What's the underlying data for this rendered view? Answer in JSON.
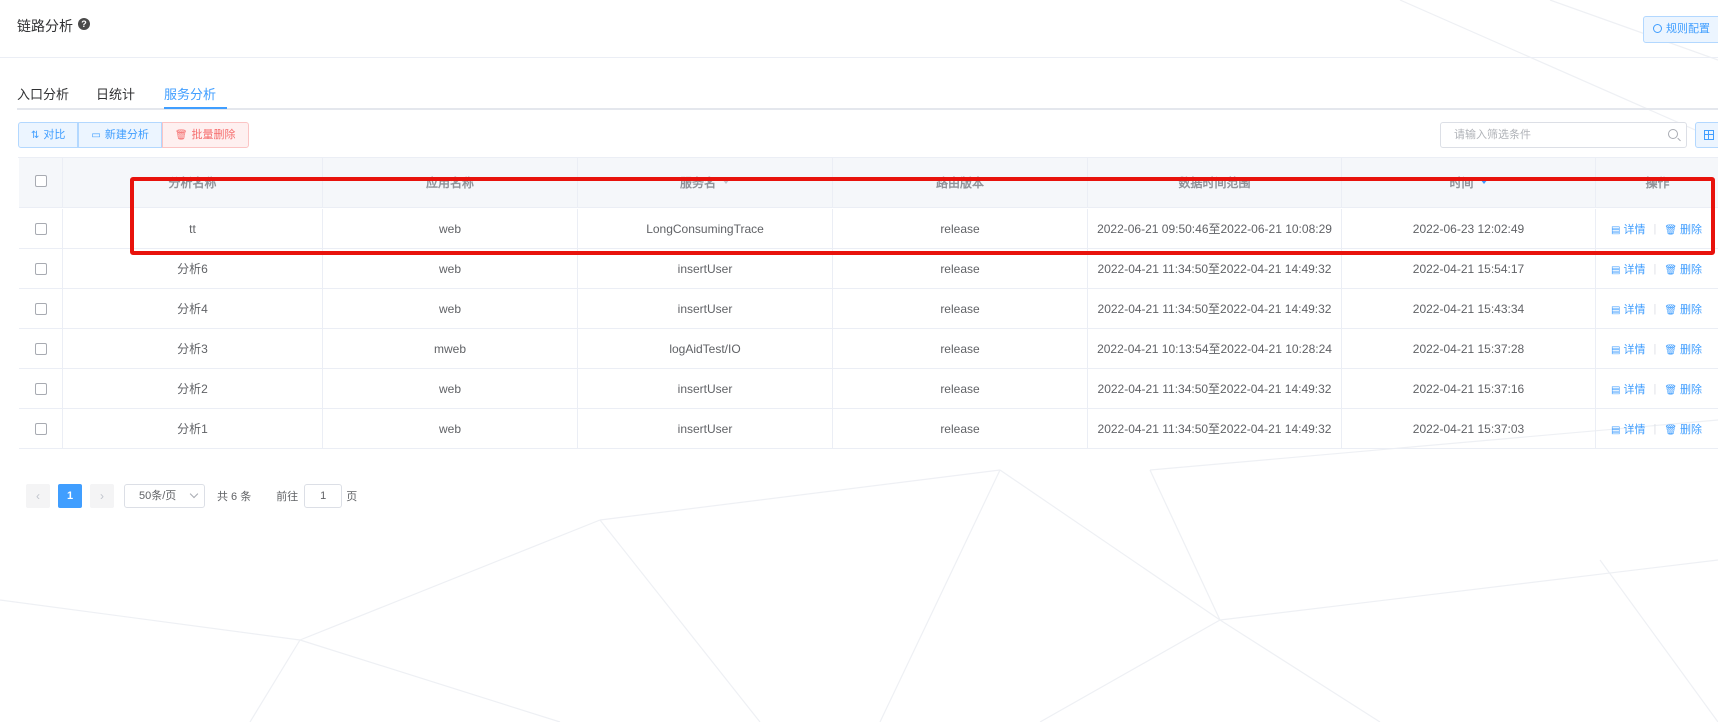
{
  "header": {
    "title": "链路分析",
    "help_icon": "question-circle-icon",
    "rule_config_label": "规则配置"
  },
  "tabs": [
    {
      "label": "入口分析",
      "active": false
    },
    {
      "label": "日统计",
      "active": false
    },
    {
      "label": "服务分析",
      "active": true
    }
  ],
  "toolbar": {
    "compare_label": "对比",
    "new_analysis_label": "新建分析",
    "batch_delete_label": "批量删除",
    "search_placeholder": "请输入筛选条件"
  },
  "table": {
    "columns": [
      "分析名称",
      "应用名称",
      "服务名",
      "路由版本",
      "数据时间范围",
      "时间",
      "操作"
    ],
    "rows": [
      {
        "name": "tt",
        "app": "web",
        "service": "LongConsumingTrace",
        "version": "release",
        "range": "2022-06-21 09:50:46至2022-06-21 10:08:29",
        "time": "2022-06-23 12:02:49"
      },
      {
        "name": "分析6",
        "app": "web",
        "service": "insertUser",
        "version": "release",
        "range": "2022-04-21 11:34:50至2022-04-21 14:49:32",
        "time": "2022-04-21 15:54:17"
      },
      {
        "name": "分析4",
        "app": "web",
        "service": "insertUser",
        "version": "release",
        "range": "2022-04-21 11:34:50至2022-04-21 14:49:32",
        "time": "2022-04-21 15:43:34"
      },
      {
        "name": "分析3",
        "app": "mweb",
        "service": "logAidTest/IO",
        "version": "release",
        "range": "2022-04-21 10:13:54至2022-04-21 10:28:24",
        "time": "2022-04-21 15:37:28"
      },
      {
        "name": "分析2",
        "app": "web",
        "service": "insertUser",
        "version": "release",
        "range": "2022-04-21 11:34:50至2022-04-21 14:49:32",
        "time": "2022-04-21 15:37:16"
      },
      {
        "name": "分析1",
        "app": "web",
        "service": "insertUser",
        "version": "release",
        "range": "2022-04-21 11:34:50至2022-04-21 14:49:32",
        "time": "2022-04-21 15:37:03"
      }
    ],
    "detail_label": "详情",
    "delete_label": "删除"
  },
  "pagination": {
    "current_page": "1",
    "page_size": "50条/页",
    "total": "共 6 条",
    "goto_prefix": "前往",
    "goto_value": "1",
    "goto_suffix": "页"
  },
  "colors": {
    "primary": "#409eff",
    "danger": "#f56c6c",
    "highlight": "#e8120c"
  }
}
